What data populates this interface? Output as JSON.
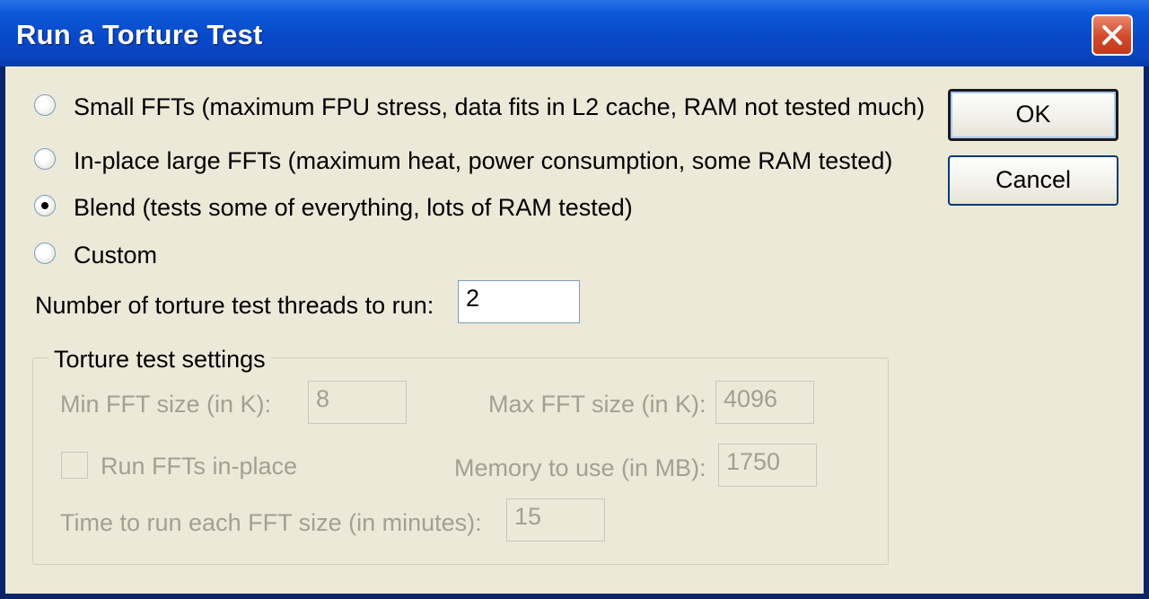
{
  "window": {
    "title": "Run a Torture Test"
  },
  "options": [
    {
      "label": "Small FFTs (maximum FPU stress, data fits in L2 cache, RAM not tested much)",
      "selected": false
    },
    {
      "label": "In-place large FFTs (maximum heat, power consumption, some RAM tested)",
      "selected": false
    },
    {
      "label": "Blend (tests some of everything, lots of RAM tested)",
      "selected": true
    },
    {
      "label": "Custom",
      "selected": false
    }
  ],
  "threads": {
    "label": "Number of torture test threads to run:",
    "value": "2"
  },
  "settings": {
    "title": "Torture test settings",
    "min_fft": {
      "label": "Min FFT size (in K):",
      "value": "8"
    },
    "max_fft": {
      "label": "Max FFT size (in K):",
      "value": "4096"
    },
    "in_place": {
      "label": "Run FFTs in-place",
      "checked": false
    },
    "memory": {
      "label": "Memory to use (in MB):",
      "value": "1750"
    },
    "time": {
      "label": "Time to run each FFT size (in minutes):",
      "value": "15"
    }
  },
  "buttons": {
    "ok": "OK",
    "cancel": "Cancel"
  },
  "colors": {
    "titlebar": "#0a44bd",
    "dialog_bg": "#ece9d8",
    "disabled_text": "#a3a091",
    "close_button": "#d2492b"
  }
}
